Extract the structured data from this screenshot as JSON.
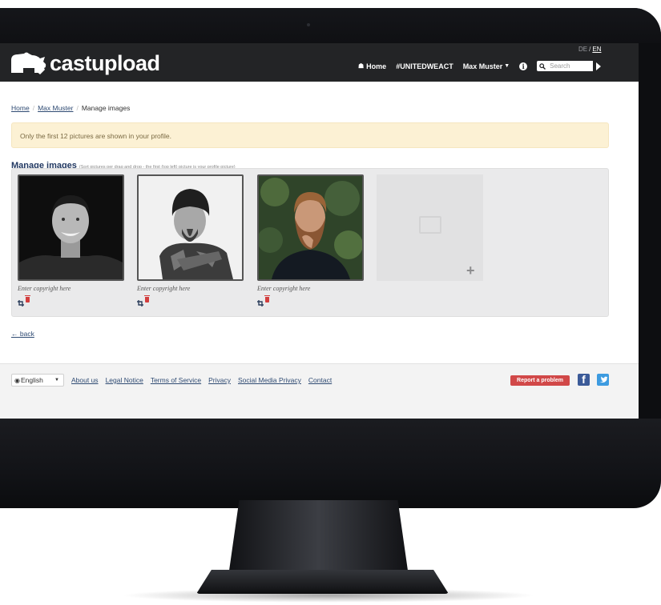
{
  "header": {
    "logo_text": "castupload",
    "lang_de": "DE",
    "lang_sep": "/",
    "lang_en": "EN",
    "nav": {
      "home": "Home",
      "campaign": "#UNITEDWEACT",
      "user": "Max Muster"
    },
    "search_placeholder": "Search"
  },
  "breadcrumb": {
    "home": "Home",
    "user": "Max Muster",
    "current": "Manage images",
    "divider": "/"
  },
  "alert_text": "Only the first 12 pictures are shown in your profile.",
  "section": {
    "title": "Manage images",
    "hint": "(Sort pictures per drag and drop - the first (top left) picture is your profile picture)"
  },
  "images": [
    {
      "copyright_placeholder": "Enter copyright here"
    },
    {
      "copyright_placeholder": "Enter copyright here"
    },
    {
      "copyright_placeholder": "Enter copyright here"
    }
  ],
  "back_link": "← back",
  "footer": {
    "language": "English",
    "links": [
      "About us",
      "Legal Notice",
      "Terms of Service",
      "Privacy",
      "Social Media Privacy",
      "Contact"
    ],
    "report_button": "Report a problem"
  },
  "icons": {
    "home": "home-icon",
    "info": "info-circle-icon",
    "search": "search-icon",
    "crop": "crop-icon",
    "delete": "trash-icon",
    "add": "plus-icon",
    "facebook": "facebook-icon",
    "twitter": "twitter-icon",
    "globe": "globe-icon"
  },
  "colors": {
    "topbar": "#232426",
    "link": "#2f4b73",
    "alert_bg": "#fcf1d4",
    "report": "#d14848",
    "facebook": "#3b5a98",
    "twitter": "#3d9be0"
  }
}
